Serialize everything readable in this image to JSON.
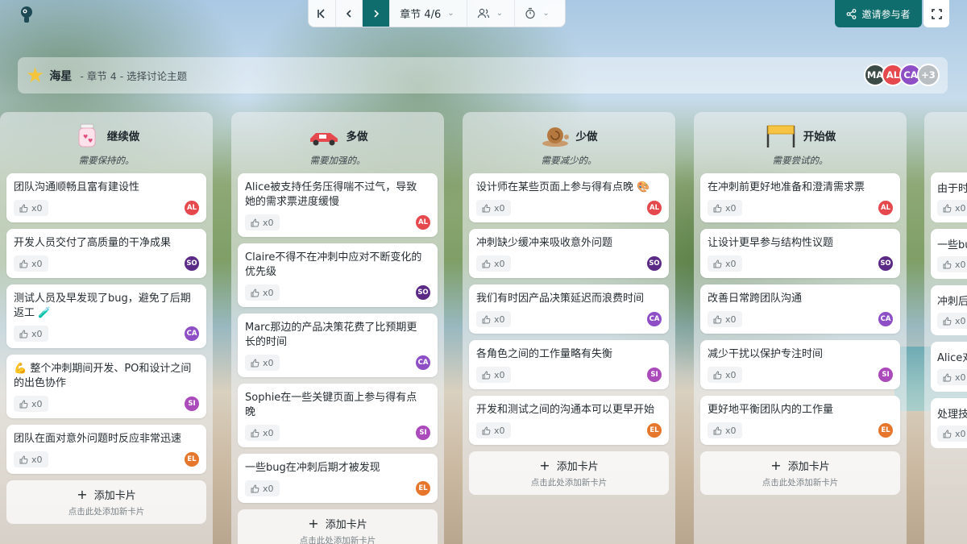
{
  "topbar": {
    "section_label": "章节 4/6",
    "invite_label": "邀请参与者"
  },
  "header": {
    "title": "海星",
    "subtitle": "- 章节 4 - 选择讨论主题",
    "avatars": [
      {
        "initials": "MA",
        "color": "#3b4a45"
      },
      {
        "initials": "AL",
        "color": "#e5484d"
      },
      {
        "initials": "CA",
        "color": "#8e4ec6"
      },
      {
        "initials": "+3",
        "color": "#b9bec3"
      }
    ]
  },
  "add_card": {
    "label": "添加卡片",
    "hint": "点击此处添加新卡片"
  },
  "columns": [
    {
      "title": "继续做",
      "desc": "需要保持的。",
      "cards": [
        {
          "text": "团队沟通顺畅且富有建设性",
          "likes": "x0",
          "author": "AL",
          "color": "#e5484d"
        },
        {
          "text": "开发人员交付了高质量的干净成果",
          "likes": "x0",
          "author": "SO",
          "color": "#5b2a86"
        },
        {
          "text": "测试人员及早发现了bug，避免了后期返工 🧪",
          "likes": "x0",
          "author": "CA",
          "color": "#8e4ec6"
        },
        {
          "text": "💪 整个冲刺期间开发、PO和设计之间的出色协作",
          "likes": "x0",
          "author": "SI",
          "color": "#ab4aba"
        },
        {
          "text": "团队在面对意外问题时反应非常迅速",
          "likes": "x0",
          "author": "EL",
          "color": "#e5762b"
        }
      ]
    },
    {
      "title": "多做",
      "desc": "需要加强的。",
      "cards": [
        {
          "text": "Alice被支持任务压得喘不过气，导致她的需求票进度缓慢",
          "likes": "x0",
          "author": "AL",
          "color": "#e5484d"
        },
        {
          "text": "Claire不得不在冲刺中应对不断变化的优先级",
          "likes": "x0",
          "author": "SO",
          "color": "#5b2a86"
        },
        {
          "text": "Marc那边的产品决策花费了比预期更长的时间",
          "likes": "x0",
          "author": "CA",
          "color": "#8e4ec6"
        },
        {
          "text": "Sophie在一些关键页面上参与得有点晚",
          "likes": "x0",
          "author": "SI",
          "color": "#ab4aba"
        },
        {
          "text": "一些bug在冲刺后期才被发现",
          "likes": "x0",
          "author": "EL",
          "color": "#e5762b"
        }
      ]
    },
    {
      "title": "少做",
      "desc": "需要减少的。",
      "cards": [
        {
          "text": "设计师在某些页面上参与得有点晚 🎨",
          "likes": "x0",
          "author": "AL",
          "color": "#e5484d"
        },
        {
          "text": "冲刺缺少缓冲来吸收意外问题",
          "likes": "x0",
          "author": "SO",
          "color": "#5b2a86"
        },
        {
          "text": "我们有时因产品决策延迟而浪费时间",
          "likes": "x0",
          "author": "CA",
          "color": "#8e4ec6"
        },
        {
          "text": "各角色之间的工作量略有失衡",
          "likes": "x0",
          "author": "SI",
          "color": "#ab4aba"
        },
        {
          "text": "开发和测试之间的沟通本可以更早开始",
          "likes": "x0",
          "author": "EL",
          "color": "#e5762b"
        }
      ]
    },
    {
      "title": "开始做",
      "desc": "需要尝试的。",
      "cards": [
        {
          "text": "在冲刺前更好地准备和澄清需求票",
          "likes": "x0",
          "author": "AL",
          "color": "#e5484d"
        },
        {
          "text": "让设计更早参与结构性议题",
          "likes": "x0",
          "author": "SO",
          "color": "#5b2a86"
        },
        {
          "text": "改善日常跨团队沟通",
          "likes": "x0",
          "author": "CA",
          "color": "#8e4ec6"
        },
        {
          "text": "减少干扰以保护专注时间",
          "likes": "x0",
          "author": "SI",
          "color": "#ab4aba"
        },
        {
          "text": "更好地平衡团队内的工作量",
          "likes": "x0",
          "author": "EL",
          "color": "#e5762b"
        }
      ]
    }
  ],
  "ghost_column": {
    "cards": [
      {
        "text": "由于时",
        "likes": "x0"
      },
      {
        "text": "一些bu",
        "likes": "x0"
      },
      {
        "text": "冲刺后",
        "likes": "x0"
      },
      {
        "text": "Alice对",
        "likes": "x0"
      },
      {
        "text": "处理技",
        "likes": "x0"
      }
    ]
  }
}
